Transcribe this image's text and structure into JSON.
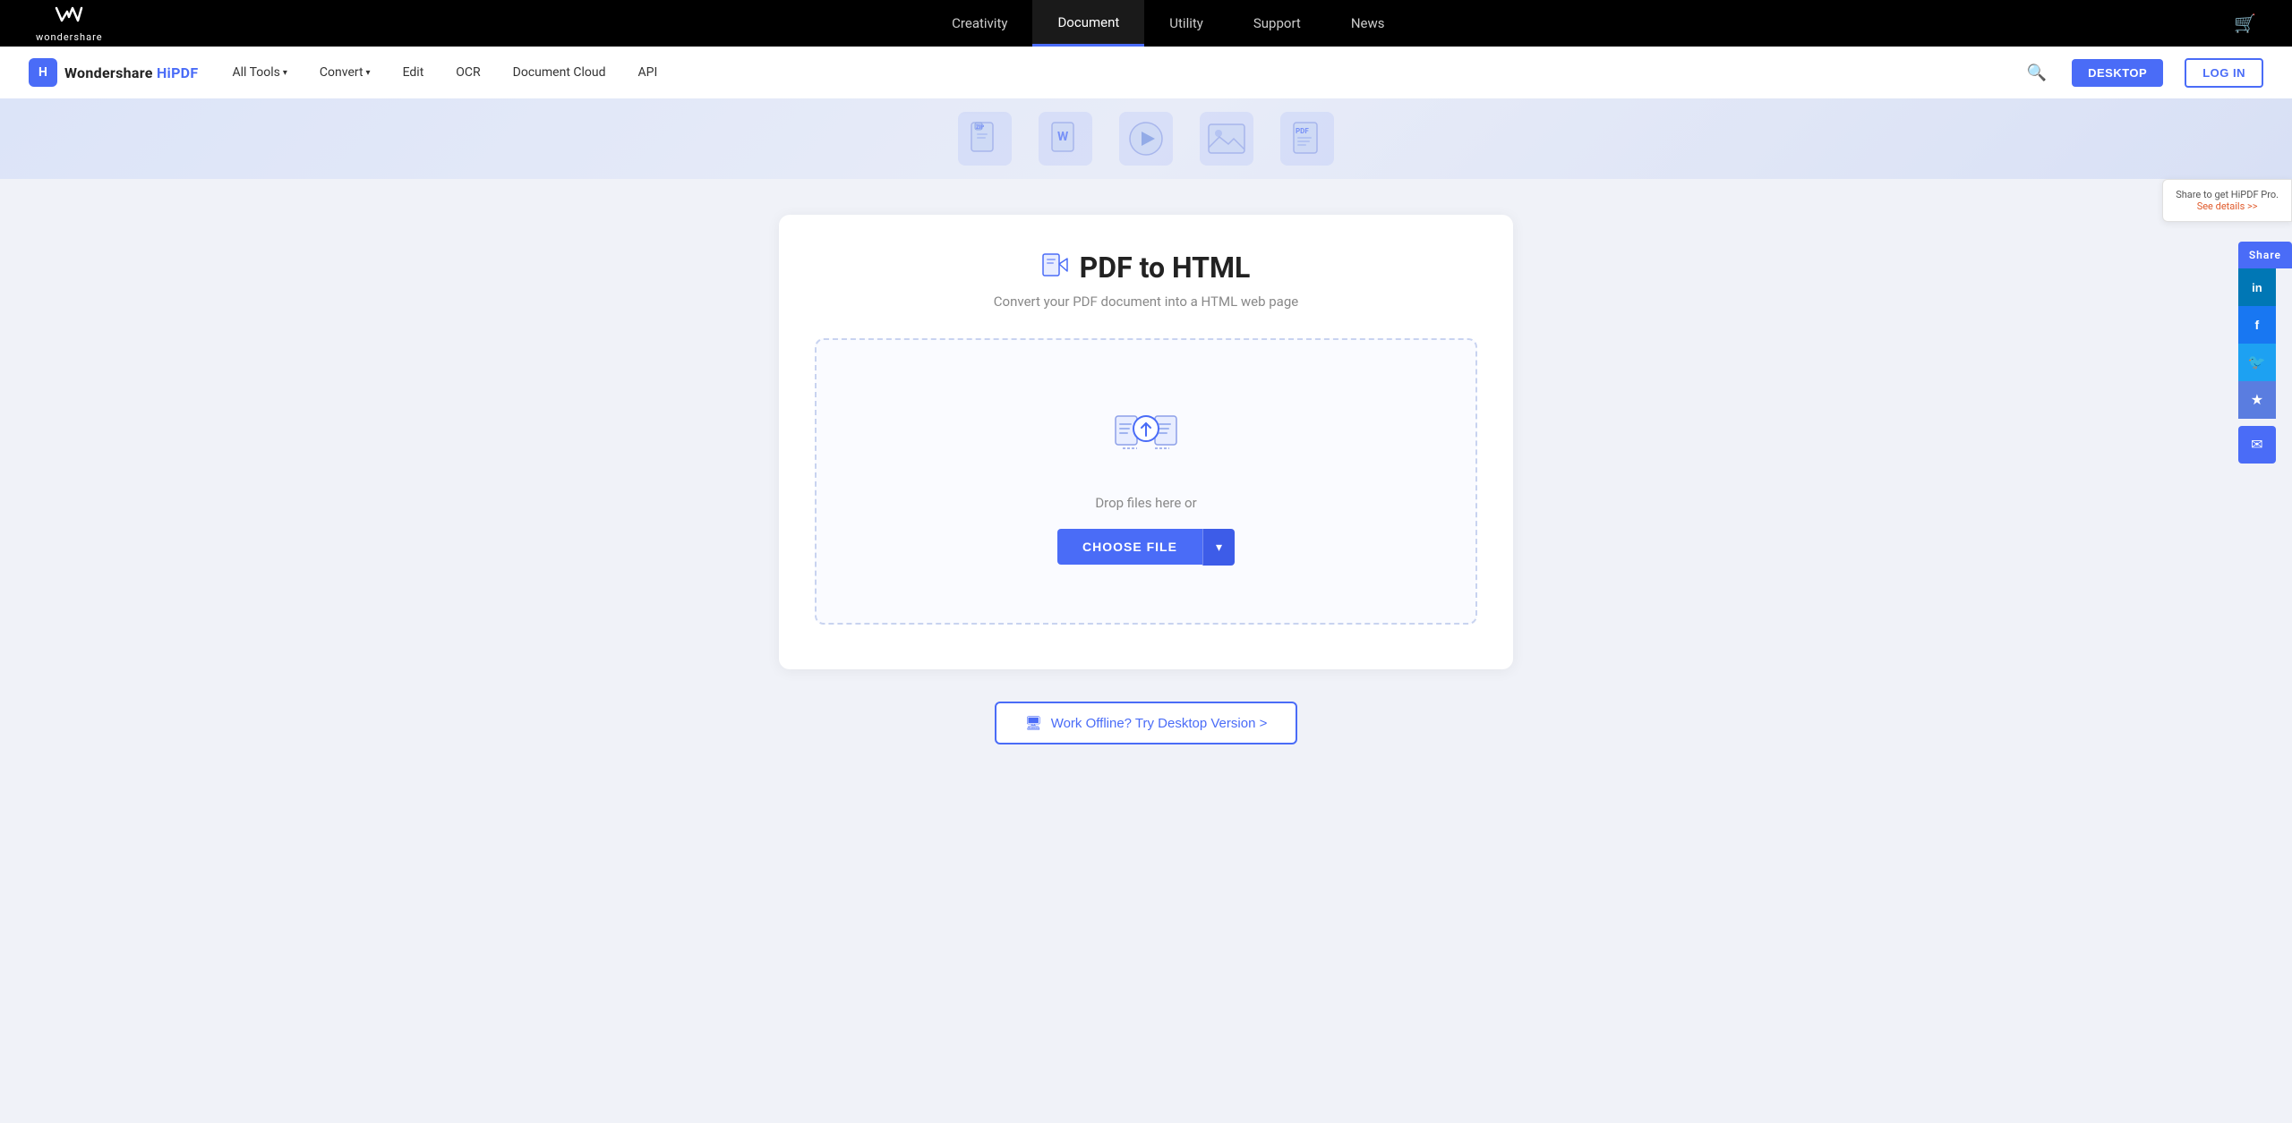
{
  "top_nav": {
    "logo_symbol": "⌘",
    "logo_name": "wondershare",
    "links": [
      {
        "id": "creativity",
        "label": "Creativity",
        "active": false
      },
      {
        "id": "document",
        "label": "Document",
        "active": true
      },
      {
        "id": "utility",
        "label": "Utility",
        "active": false
      },
      {
        "id": "support",
        "label": "Support",
        "active": false
      },
      {
        "id": "news",
        "label": "News",
        "active": false
      }
    ]
  },
  "secondary_nav": {
    "brand": "Wondershare HiPDF",
    "links": [
      {
        "id": "all-tools",
        "label": "All Tools",
        "has_dropdown": true
      },
      {
        "id": "convert",
        "label": "Convert",
        "has_dropdown": true
      },
      {
        "id": "edit",
        "label": "Edit",
        "has_dropdown": false
      },
      {
        "id": "ocr",
        "label": "OCR",
        "has_dropdown": false
      },
      {
        "id": "document-cloud",
        "label": "Document Cloud",
        "has_dropdown": false
      },
      {
        "id": "api",
        "label": "API",
        "has_dropdown": false
      }
    ],
    "btn_desktop": "DESKTOP",
    "btn_login": "LOG IN"
  },
  "tool": {
    "title": "PDF to HTML",
    "subtitle": "Convert your PDF document into a HTML web page",
    "drop_zone_text": "Drop files here or",
    "choose_file_btn": "CHOOSE FILE",
    "choose_dropdown_icon": "▾",
    "offline_btn": "Work Offline? Try Desktop Version >"
  },
  "share_panel": {
    "promo_text": "Share to get HiPDF Pro.",
    "promo_link": "See details >>",
    "share_label": "Share",
    "social": [
      {
        "id": "linkedin",
        "icon": "in"
      },
      {
        "id": "facebook",
        "icon": "f"
      },
      {
        "id": "twitter",
        "icon": "🐦"
      },
      {
        "id": "bookmark",
        "icon": "★"
      },
      {
        "id": "email",
        "icon": "✉"
      }
    ]
  }
}
